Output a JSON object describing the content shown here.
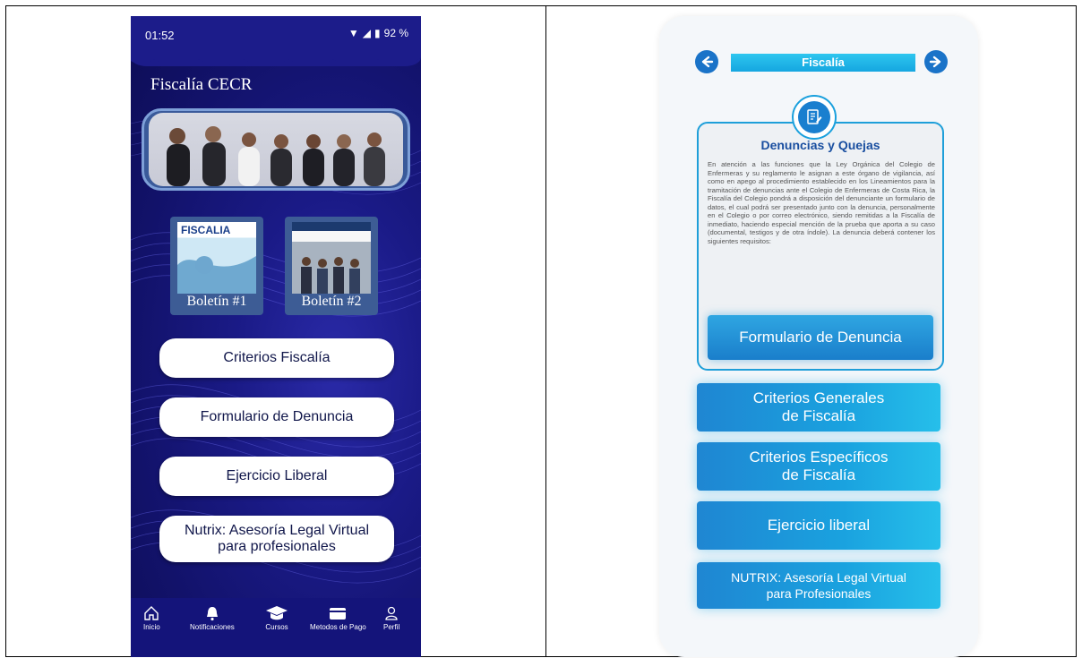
{
  "left": {
    "status": {
      "time": "01:52",
      "battery": "92 %"
    },
    "title": "Fiscalía CECR",
    "bulletins": [
      {
        "label": "Boletín #1",
        "cover_title": "FISCALIA"
      },
      {
        "label": "Boletín #2",
        "cover_title": ""
      }
    ],
    "buttons": [
      "Criterios Fiscalía",
      "Formulario de Denuncia",
      "Ejercicio Liberal",
      "Nutrix: Asesoría Legal Virtual para profesionales"
    ],
    "buttons_split": {
      "nutrix_line1": "Nutrix: Asesoría Legal Virtual",
      "nutrix_line2": "para profesionales"
    },
    "nav": [
      "Inicio",
      "Notificaciones",
      "Cursos",
      "Metodos de Pago",
      "Perfil"
    ],
    "colors": {
      "background": "#14147a",
      "pill": "#ffffff",
      "pill_text": "#10164a"
    }
  },
  "right": {
    "header": "Fiscalía",
    "card": {
      "title": "Denuncias y Quejas",
      "body": "En atención a las funciones que la Ley Orgánica del Colegio de Enfermeras y su reglamento le asignan a este órgano de vigilancia, así como en apego al procedimiento establecido en los Lineamientos para la tramitación de denuncias ante el Colegio de Enfermeras de Costa Rica, la Fiscalía del Colegio pondrá a disposición del denunciante un formulario de datos, el cual podrá ser presentado junto con la denuncia, personalmente en el Colegio o por correo electrónico, siendo remitidas a la Fiscalía de inmediato, haciendo especial mención de la prueba que aporta a su caso (documental, testigos y de otra índole). La denuncia deberá contener los siguientes requisitos:",
      "cta": "Formulario de Denuncia"
    },
    "buttons": [
      {
        "line1": "Criterios Generales",
        "line2": "de Fiscalía"
      },
      {
        "line1": "Criterios Específicos",
        "line2": "de Fiscalía"
      },
      {
        "line1": "Ejercicio liberal",
        "line2": ""
      },
      {
        "line1": "NUTRIX: Asesoría Legal Virtual",
        "line2": "para Profesionales"
      }
    ],
    "colors": {
      "accent": "#1aa2df",
      "title": "#1a4fa0"
    }
  }
}
